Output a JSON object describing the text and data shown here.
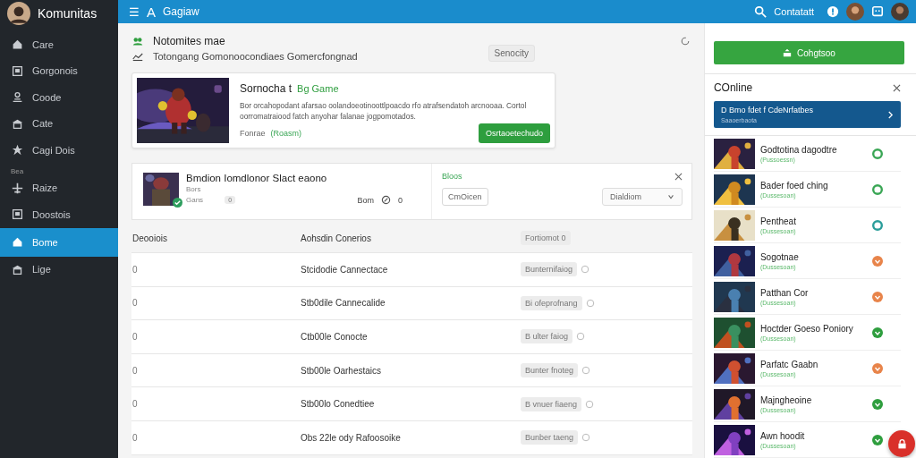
{
  "sidebar": {
    "user": "Komunitas",
    "items": [
      {
        "label": "Care",
        "selected": false
      },
      {
        "label": "Gorgonois",
        "selected": false
      },
      {
        "label": "Coode",
        "selected": false
      },
      {
        "label": "Cate",
        "selected": false
      },
      {
        "label": "Cagi Dois",
        "selected": false
      },
      {
        "section": "Bea",
        "label": "Raize",
        "selected": false
      },
      {
        "label": "Doostois",
        "selected": false
      },
      {
        "label": "Bome",
        "selected": true
      },
      {
        "label": "Lige",
        "selected": false
      }
    ]
  },
  "topbar": {
    "menu": "☰",
    "letter": "A",
    "title": "Gagiaw",
    "search": "Contatatt"
  },
  "header": {
    "title": "Notomites mae",
    "subtitle": "Totongang Gomonoocondiaes Gomercfongnad",
    "button": "Senocity"
  },
  "featured": {
    "title": "Sornocha t",
    "tag": "Bg Game",
    "description": "Bor orcahopodant afarsao oolandoeotinoottlpoacdo rfo atrafsendatoh arcnooaa. Cortol oorromatraiood fatch anyohar falanae jogpomotados.",
    "meta": "Fonrae",
    "meta_tag": "(Roasm)",
    "button": "Osrtaoetechudo"
  },
  "match": {
    "title": "Bmdion Iomdlonor Slact eaono",
    "line1": "Bors",
    "line2": "Gans",
    "chip": "0",
    "right_label": "Bom",
    "right_value": "0",
    "status": "Bloos",
    "button": "CmOicen",
    "dropdown": "Dialdiom"
  },
  "table": {
    "columns": [
      "Deooiois",
      "Aohsdin Conerios",
      "Fortiomot 0"
    ],
    "rows": [
      [
        "0",
        "Stcidodie Cannectace",
        "Bunternifaiog"
      ],
      [
        "0",
        "Stb0dile Cannecalide",
        "Bi ofeprofnang"
      ],
      [
        "0",
        "Ctb00le Conocte",
        "B ulter faiog"
      ],
      [
        "0",
        "Stb00le Oarhestaics",
        "Bunter fnoteg"
      ],
      [
        "0",
        "Stb00lo Conedtiee",
        "B vnuer fiaeng"
      ],
      [
        "0",
        "Obs 22le ody Rafoosoike",
        "Bunber taeng"
      ]
    ]
  },
  "panel": {
    "button": "Cohgtsoo",
    "title": "COnline",
    "banner_title": "D  Bmo fdet f CdeNrfatbes",
    "banner_sub": "Saaoerbaota",
    "games": [
      {
        "title": "Godtotina dagodtre",
        "sub": "(Pussoessn)",
        "kind": "ring",
        "color": "#3aa655"
      },
      {
        "title": "Bader foed ching",
        "sub": "(Dussesoan)",
        "kind": "ring",
        "color": "#3aa655"
      },
      {
        "title": "Pentheat",
        "sub": "(Dussesoan)",
        "kind": "ring",
        "color": "#2a9d9a"
      },
      {
        "title": "Sogotnae",
        "sub": "(Dussesoan)",
        "kind": "solid",
        "color": "#e8844a"
      },
      {
        "title": "Patthan Cor",
        "sub": "(Dussesoan)",
        "kind": "solid",
        "color": "#e8844a"
      },
      {
        "title": "Hoctder Goeso Poniory",
        "sub": "(Dussesoan)",
        "kind": "solid",
        "color": "#2e9e3e"
      },
      {
        "title": "Parfatc Gaabn",
        "sub": "(Dussesoan)",
        "kind": "solid",
        "color": "#e8844a"
      },
      {
        "title": "Majngheoine",
        "sub": "(Dussesoan)",
        "kind": "solid",
        "color": "#2e9e3e"
      },
      {
        "title": "Awn hoodit",
        "sub": "(Dussesoan)",
        "kind": "solid",
        "color": "#2e9e3e"
      }
    ]
  }
}
